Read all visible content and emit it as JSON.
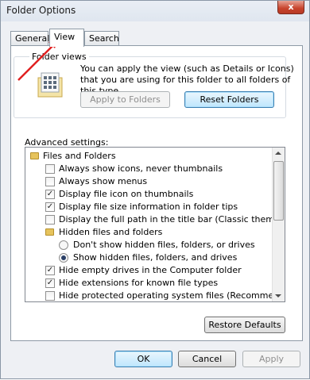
{
  "window": {
    "title": "Folder Options",
    "close_label": "x"
  },
  "tabs": [
    {
      "label": "General"
    },
    {
      "label": "View"
    },
    {
      "label": "Search"
    }
  ],
  "folder_views": {
    "group_label": "Folder views",
    "description": "You can apply the view (such as Details or Icons) that you are using for this folder to all folders of this type.",
    "apply_button": "Apply to Folders",
    "reset_button": "Reset Folders"
  },
  "advanced": {
    "label": "Advanced settings:",
    "items": [
      {
        "type": "folder",
        "label": "Files and Folders"
      },
      {
        "type": "checkbox",
        "label": "Always show icons, never thumbnails",
        "checked": false
      },
      {
        "type": "checkbox",
        "label": "Always show menus",
        "checked": false
      },
      {
        "type": "checkbox",
        "label": "Display file icon on thumbnails",
        "checked": true
      },
      {
        "type": "checkbox",
        "label": "Display file size information in folder tips",
        "checked": true
      },
      {
        "type": "checkbox",
        "label": "Display the full path in the title bar (Classic theme only)",
        "checked": false
      },
      {
        "type": "folder",
        "label": "Hidden files and folders"
      },
      {
        "type": "radio",
        "label": "Don't show hidden files, folders, or drives",
        "checked": false
      },
      {
        "type": "radio",
        "label": "Show hidden files, folders, and drives",
        "checked": true
      },
      {
        "type": "checkbox",
        "label": "Hide empty drives in the Computer folder",
        "checked": true
      },
      {
        "type": "checkbox",
        "label": "Hide extensions for known file types",
        "checked": true
      },
      {
        "type": "checkbox",
        "label": "Hide protected operating system files (Recommended)",
        "checked": false
      }
    ]
  },
  "restore_button": "Restore Defaults",
  "footer": {
    "ok": "OK",
    "cancel": "Cancel",
    "apply": "Apply"
  },
  "colors": {
    "annotation_arrow": "#e02020",
    "window_bg": "#eef0f4",
    "default_button_border": "#3c7fb1"
  }
}
